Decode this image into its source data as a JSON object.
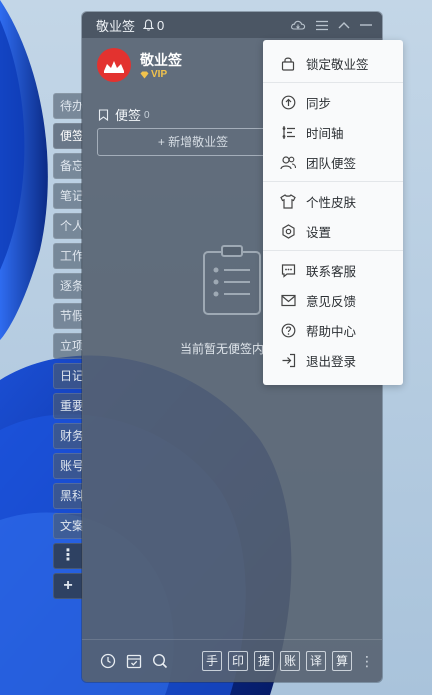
{
  "window": {
    "title": "敬业签",
    "notification_count": "0",
    "app_name": "敬业签",
    "vip_label": "VIP"
  },
  "side_tabs": [
    "待办",
    "便签",
    "备忘",
    "笔记",
    "个人",
    "工作",
    "逐条",
    "节假",
    "立项",
    "日记",
    "重要",
    "财务",
    "账号",
    "黑科",
    "文案"
  ],
  "side_buttons": {
    "more": "⋮",
    "add": "+"
  },
  "section": {
    "title": "便签",
    "count": "0",
    "add_button": "+ 新增敬业签"
  },
  "empty_state": {
    "text": "当前暂无便签内容"
  },
  "bottom_tools": [
    "手",
    "印",
    "捷",
    "账",
    "译",
    "算"
  ],
  "menu": {
    "groups": [
      [
        {
          "label": "锁定敬业签",
          "icon": "lock-icon"
        }
      ],
      [
        {
          "label": "同步",
          "icon": "sync-icon"
        },
        {
          "label": "时间轴",
          "icon": "timeline-icon"
        },
        {
          "label": "团队便签",
          "icon": "team-icon"
        }
      ],
      [
        {
          "label": "个性皮肤",
          "icon": "tshirt-icon"
        },
        {
          "label": "设置",
          "icon": "settings-icon"
        }
      ],
      [
        {
          "label": "联系客服",
          "icon": "chat-icon"
        },
        {
          "label": "意见反馈",
          "icon": "mail-icon"
        },
        {
          "label": "帮助中心",
          "icon": "help-icon"
        },
        {
          "label": "退出登录",
          "icon": "logout-icon"
        }
      ]
    ]
  },
  "colors": {
    "window_bg": "#566270",
    "avatar_red": "#e3322f",
    "vip_gold": "#f2c34d",
    "menu_bg": "#f9fafb"
  }
}
